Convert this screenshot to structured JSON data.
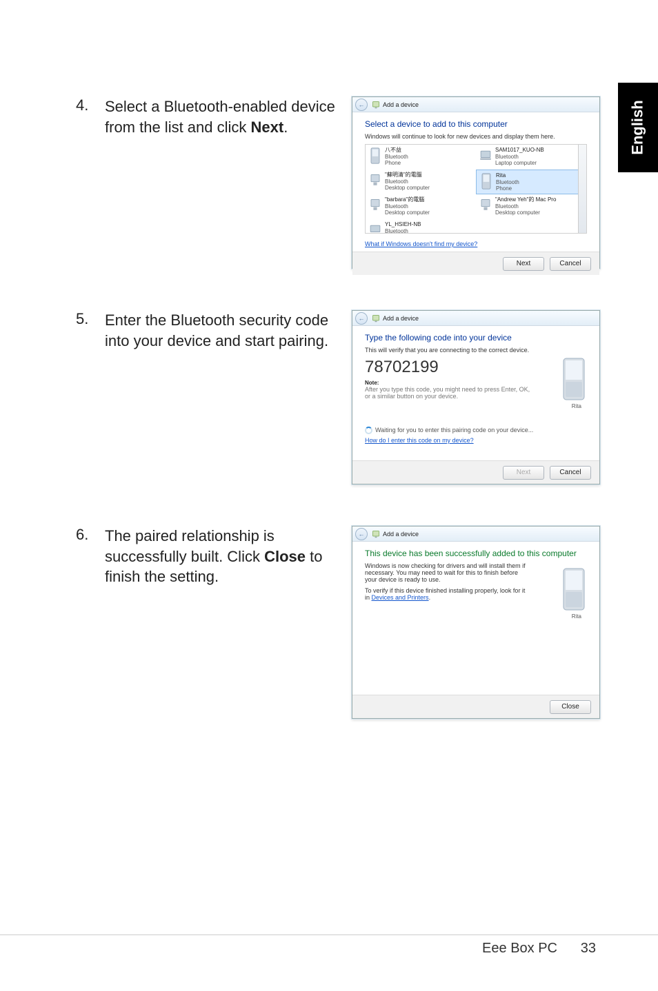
{
  "side_tab": "English",
  "steps": {
    "s4": {
      "num": "4.",
      "text_a": "Select a Bluetooth-enabled device from the list and click ",
      "text_b": "Next",
      "text_c": "."
    },
    "s5": {
      "num": "5.",
      "text": "Enter the Bluetooth security code into your device and start pairing."
    },
    "s6": {
      "num": "6.",
      "text_a": "The paired relationship is successfully built. Click ",
      "text_b": "Close",
      "text_c": " to finish the setting."
    }
  },
  "dlg1": {
    "title": "Add a device",
    "heading": "Select a device to add to this computer",
    "sub": "Windows will continue to look for new devices and display them here.",
    "devices": [
      {
        "name": "八不益",
        "t1": "Bluetooth",
        "t2": "Phone"
      },
      {
        "name": "SAM1017_KUO-NB",
        "t1": "Bluetooth",
        "t2": "Laptop computer"
      },
      {
        "name": "\"蘇明清\"的電腦",
        "t1": "Bluetooth",
        "t2": "Desktop computer"
      },
      {
        "name": "Rita",
        "t1": "Bluetooth",
        "t2": "Phone",
        "selected": true
      },
      {
        "name": "\"barbara\"的電腦",
        "t1": "Bluetooth",
        "t2": "Desktop computer"
      },
      {
        "name": "\"Andrew Yeh\"的 Mac Pro",
        "t1": "Bluetooth",
        "t2": "Desktop computer"
      },
      {
        "name": "YL_HSIEH-NB",
        "t1": "Bluetooth",
        "t2": ""
      }
    ],
    "link": "What if Windows doesn't find my device?",
    "next": "Next",
    "cancel": "Cancel"
  },
  "dlg2": {
    "title": "Add a device",
    "heading": "Type the following code into your device",
    "sub": "This will verify that you are connecting to the correct device.",
    "code": "78702199",
    "note_label": "Note:",
    "note": "After you type this code, you might need to press Enter, OK, or a similar button on your device.",
    "wait": "Waiting for you to enter this pairing code on your device...",
    "link": "How do I enter this code on my device?",
    "device_caption": "Rita",
    "next": "Next",
    "cancel": "Cancel"
  },
  "dlg3": {
    "title": "Add a device",
    "heading": "This device has been successfully added to this computer",
    "p1": "Windows is now checking for drivers and will install them if necessary. You may need to wait for this to finish before your device is ready to use.",
    "p2a": "To verify if this device finished installing properly, look for it in ",
    "p2link": "Devices and Printers",
    "device_caption": "Rita",
    "close": "Close"
  },
  "footer": {
    "product": "Eee Box PC",
    "page": "33"
  }
}
